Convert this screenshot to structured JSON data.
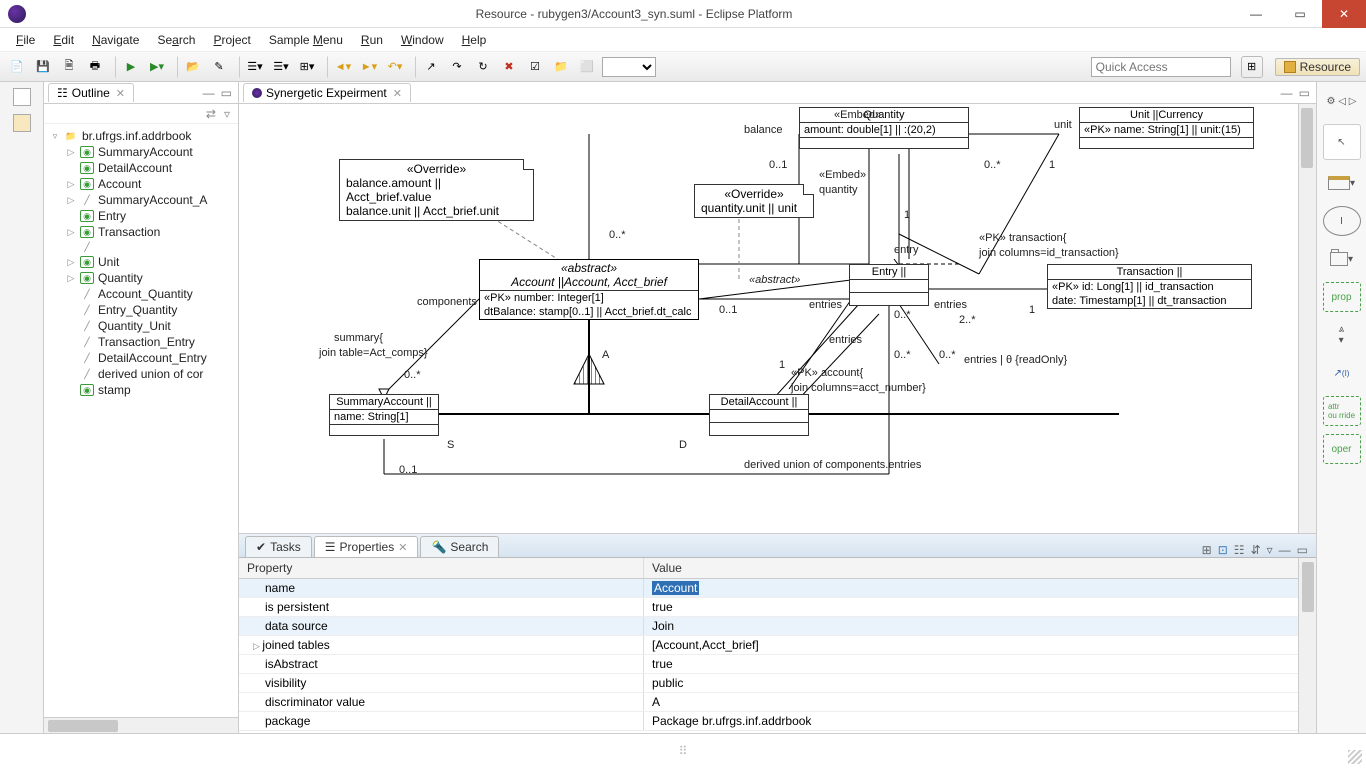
{
  "window": {
    "title": "Resource - rubygen3/Account3_syn.suml - Eclipse Platform"
  },
  "menubar": [
    "File",
    "Edit",
    "Navigate",
    "Search",
    "Project",
    "Sample Menu",
    "Run",
    "Window",
    "Help"
  ],
  "quick_access_placeholder": "Quick Access",
  "perspective": "Resource",
  "outline": {
    "title": "Outline",
    "root": "br.ufrgs.inf.addrbook",
    "items": [
      {
        "t": "cls",
        "label": "SummaryAccount",
        "exp": "▷"
      },
      {
        "t": "cls",
        "label": "DetailAccount",
        "exp": ""
      },
      {
        "t": "cls",
        "label": "Account",
        "exp": "▷"
      },
      {
        "t": "line",
        "label": "SummaryAccount_A",
        "exp": "▷"
      },
      {
        "t": "cls",
        "label": "Entry",
        "exp": ""
      },
      {
        "t": "cls",
        "label": "Transaction",
        "exp": "▷"
      },
      {
        "t": "line",
        "label": "",
        "exp": ""
      },
      {
        "t": "cls",
        "label": "Unit",
        "exp": "▷"
      },
      {
        "t": "cls",
        "label": "Quantity",
        "exp": "▷"
      },
      {
        "t": "line",
        "label": "Account_Quantity",
        "exp": ""
      },
      {
        "t": "line",
        "label": "Entry_Quantity",
        "exp": ""
      },
      {
        "t": "line",
        "label": "Quantity_Unit",
        "exp": ""
      },
      {
        "t": "line",
        "label": "Transaction_Entry",
        "exp": ""
      },
      {
        "t": "line",
        "label": "DetailAccount_Entry",
        "exp": ""
      },
      {
        "t": "line",
        "label": "derived union of cor",
        "exp": ""
      },
      {
        "t": "cls",
        "label": "stamp",
        "exp": ""
      }
    ]
  },
  "editor": {
    "title": "Synergetic Expeirment"
  },
  "diagram": {
    "notes": {
      "override1": {
        "stereo": "«Override»",
        "l1": "balance.amount || Acct_brief.value",
        "l2": "balance.unit || Acct_brief.unit"
      },
      "override2": {
        "stereo": "«Override»",
        "l1": "quantity.unit || unit"
      }
    },
    "account": {
      "stereo": "«abstract»",
      "name": "Account ||Account, Acct_brief",
      "a1": "«PK» number: Integer[1]",
      "a2": "dtBalance: stamp[0..1] || Acct_brief.dt_calc"
    },
    "quantity": {
      "name": "Quantity",
      "a1": "amount: double[1] || :(20,2)"
    },
    "unit": {
      "name": "Unit ||Currency",
      "a1": "«PK» name: String[1] || unit:(15)"
    },
    "entry": {
      "name": "Entry ||"
    },
    "transaction": {
      "name": "Transaction ||",
      "a1": "«PK» id: Long[1] || id_transaction",
      "a2": "date: Timestamp[1] || dt_transaction"
    },
    "summary": {
      "name": "SummaryAccount ||",
      "a1": "name: String[1]"
    },
    "detail": {
      "name": "DetailAccount ||"
    },
    "labels": {
      "embed_balance": "«Embed»",
      "balance": "balance",
      "m01": "0..1",
      "embed_quantity": "«Embed»",
      "quantity": "quantity",
      "one": "1",
      "unit": "unit",
      "m0s": "0..*",
      "abstract": "«abstract»",
      "entry": "entry",
      "entries": "entries",
      "m2s": "2..*",
      "pk_trans": "«PK» transaction{",
      "pk_trans2": "join columns=id_transaction}",
      "pk_acct": "«PK» account{",
      "pk_acct2": "join columns=acct_number}",
      "entries_ro": "entries | θ {readOnly}",
      "derived": "derived union of components.entries",
      "components": "components",
      "summary": "summary{",
      "summary2": "join table=Act_comps}",
      "A": "A",
      "S": "S",
      "D": "D"
    }
  },
  "tabs": {
    "tasks": "Tasks",
    "properties": "Properties",
    "search": "Search"
  },
  "props": {
    "hprop": "Property",
    "hval": "Value",
    "rows": [
      {
        "k": "name",
        "v": "Account",
        "sel": true,
        "hl": true
      },
      {
        "k": "is persistent",
        "v": "true"
      },
      {
        "k": "data source",
        "v": "Join",
        "sel2": true
      },
      {
        "k": "joined tables",
        "v": "[Account,Acct_brief]",
        "exp": "▷"
      },
      {
        "k": "isAbstract",
        "v": "true"
      },
      {
        "k": "visibility",
        "v": "public"
      },
      {
        "k": "discriminator value",
        "v": "A"
      },
      {
        "k": "package",
        "v": "Package br.ufrgs.inf.addrbook"
      }
    ]
  }
}
